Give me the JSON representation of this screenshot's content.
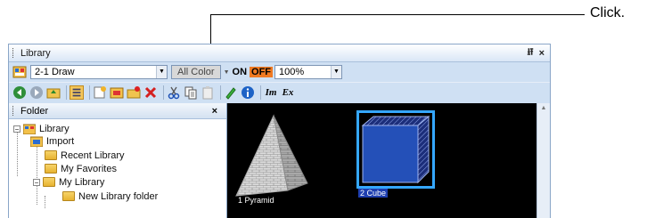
{
  "callout": {
    "label": "Click."
  },
  "window": {
    "title": "Library",
    "pin": "⭿",
    "close": "×"
  },
  "toolbar1": {
    "library_select": "2-1 Draw",
    "all_color": "All Color",
    "on": "ON",
    "off": "OFF",
    "zoom": "100%"
  },
  "toolbar2": {
    "import_label": "Im",
    "export_label": "Ex"
  },
  "folder_panel": {
    "title": "Folder",
    "close": "×",
    "tree": [
      {
        "label": "Library"
      },
      {
        "label": "Import"
      },
      {
        "label": "Recent Library"
      },
      {
        "label": "My Favorites"
      },
      {
        "label": "My Library"
      },
      {
        "label": "New Library folder"
      }
    ]
  },
  "thumbnails": [
    {
      "label": "1 Pyramid",
      "selected": false
    },
    {
      "label": "2 Cube",
      "selected": true
    }
  ],
  "colors": {
    "accent": "#2a9df4",
    "selection": "#1f3fb0",
    "off_button": "#f07a22"
  }
}
